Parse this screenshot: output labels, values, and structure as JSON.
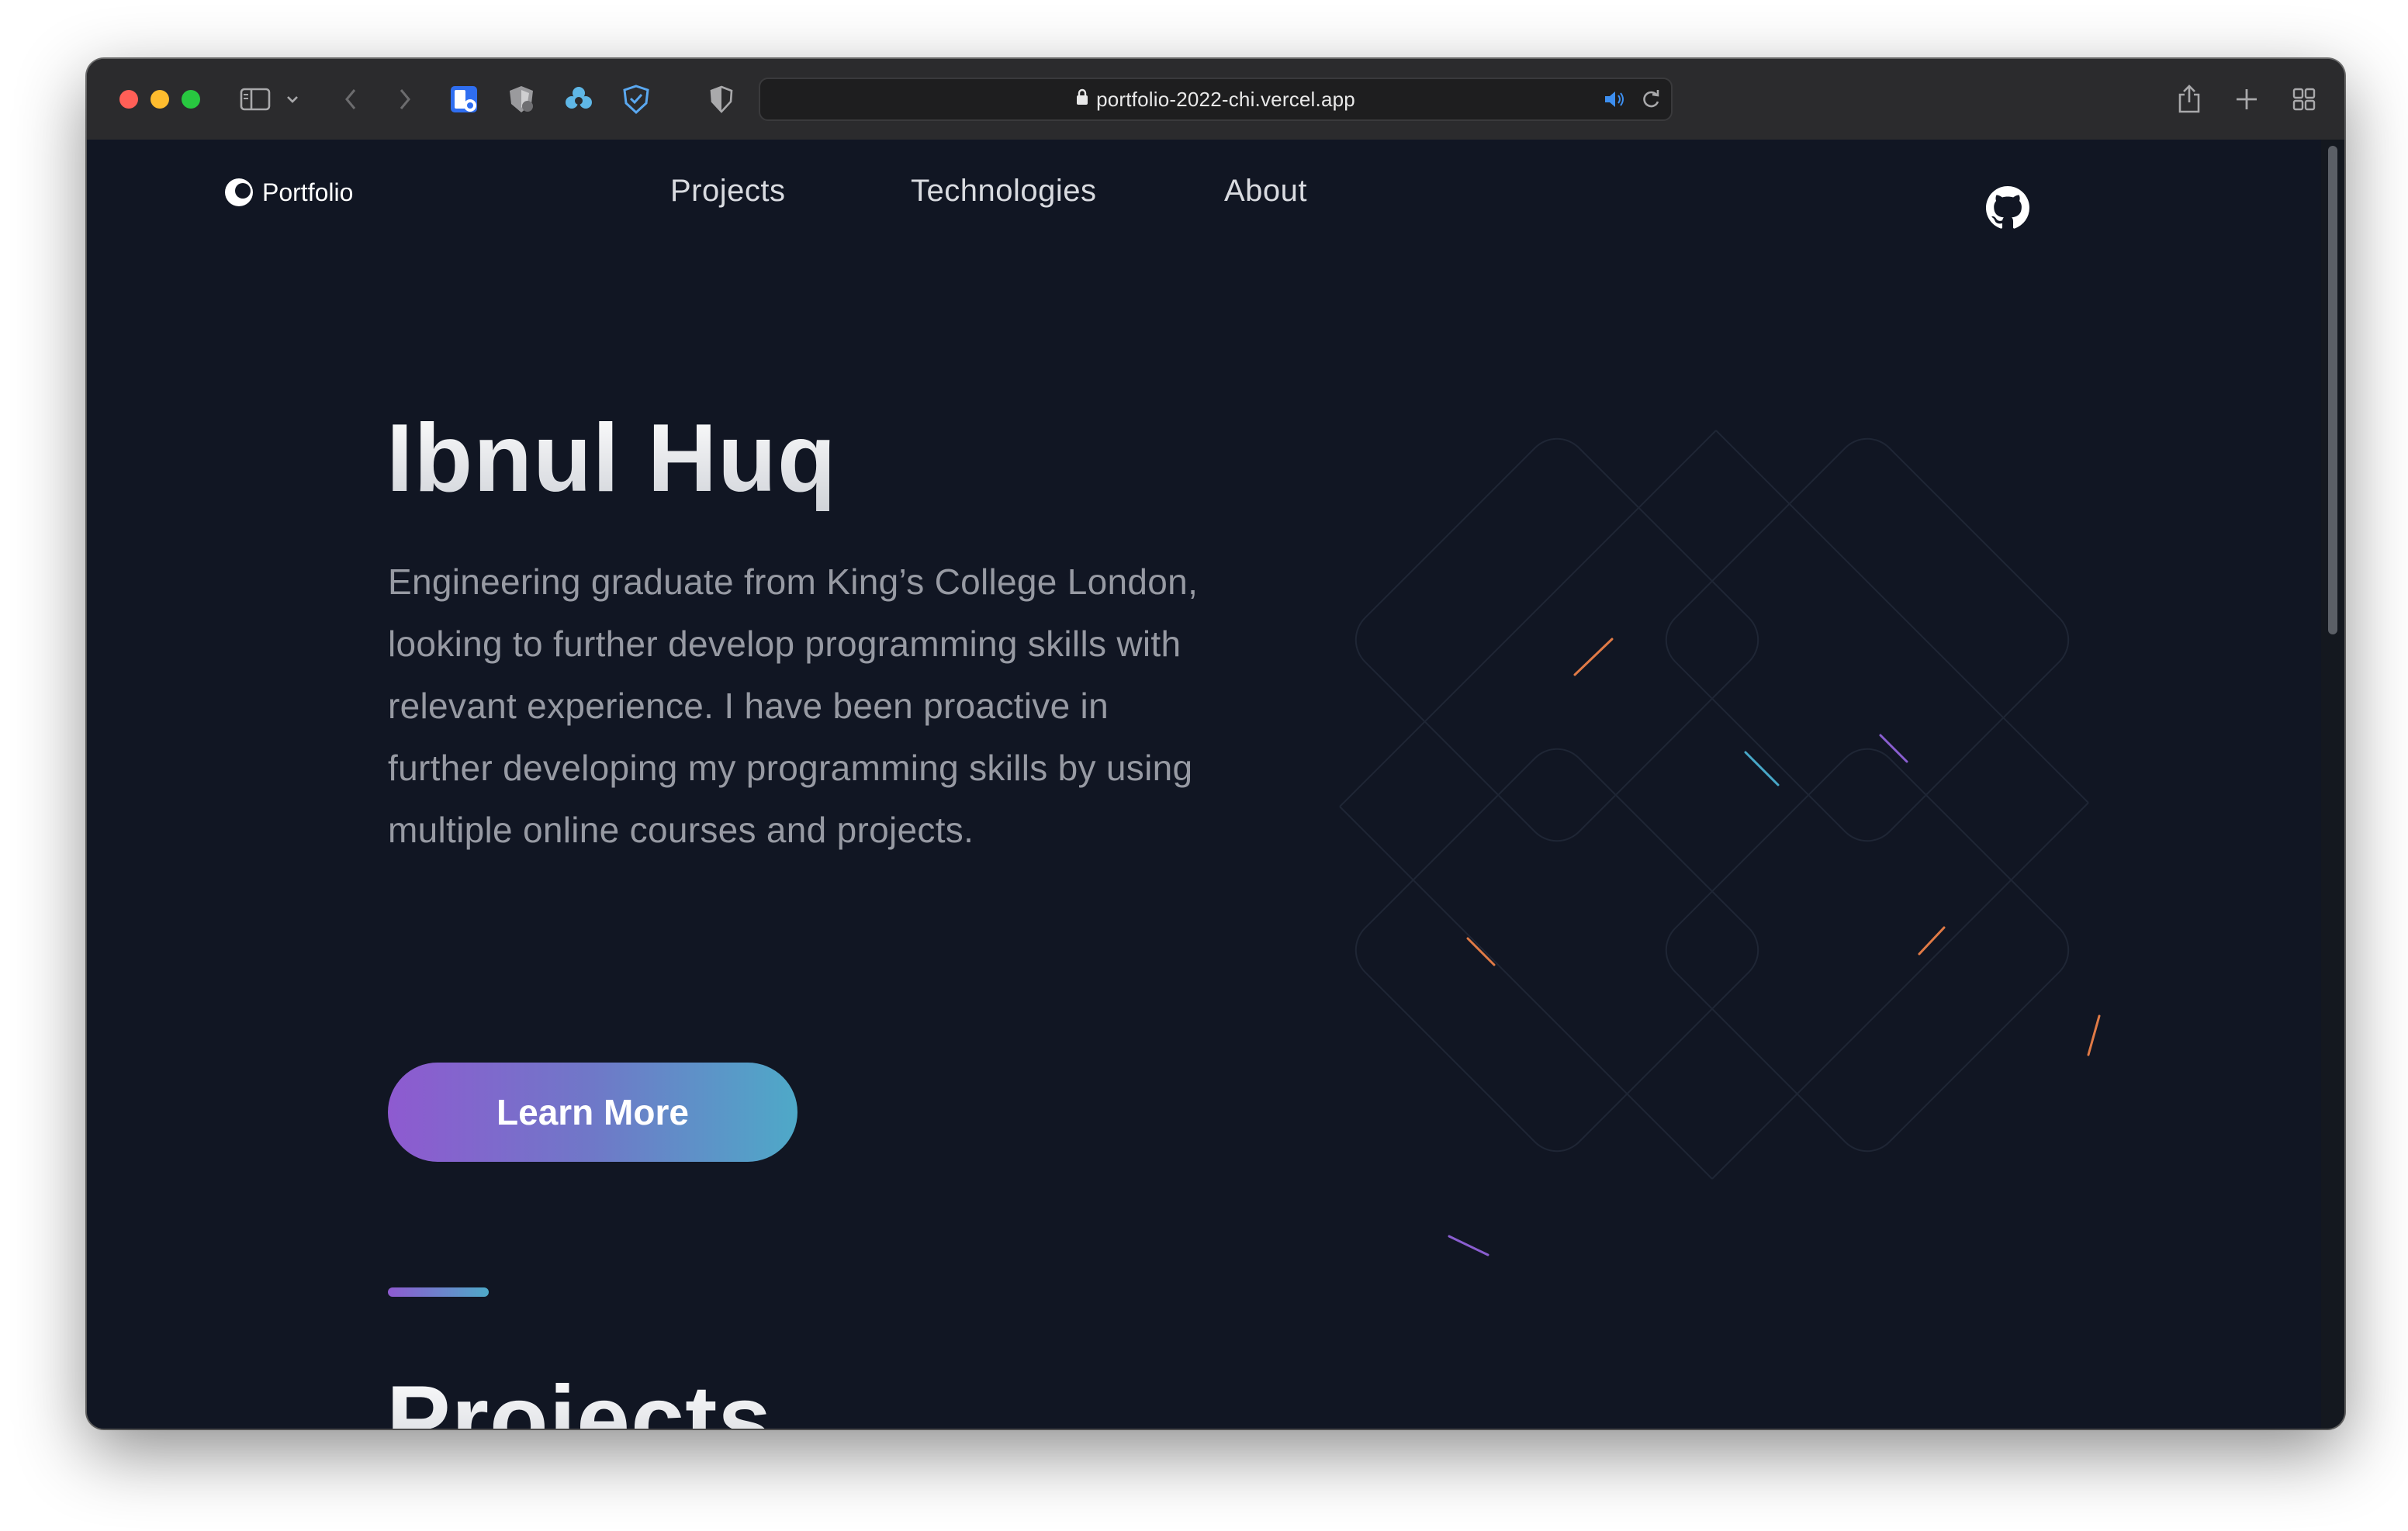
{
  "browser": {
    "url": "portfolio-2022-chi.vercel.app",
    "traffic_colors": {
      "close": "#ff5f57",
      "minimize": "#febc2e",
      "maximize": "#28c840"
    }
  },
  "site": {
    "logo_text": "Portfolio",
    "nav": [
      "Projects",
      "Technologies",
      "About"
    ],
    "github_icon": "github-icon"
  },
  "hero": {
    "title": "Ibnul Huq",
    "description": "Engineering graduate from King’s College London, looking to further develop programming skills with relevant experience. I have been proactive in further developing my programming skills by using multiple online courses and projects.",
    "cta_label": "Learn More"
  },
  "projects": {
    "title": "Projects"
  },
  "colors": {
    "background": "#111623",
    "gradient_start": "#8e5ad0",
    "gradient_end": "#4ea9c8",
    "body_text": "#979aa3"
  }
}
